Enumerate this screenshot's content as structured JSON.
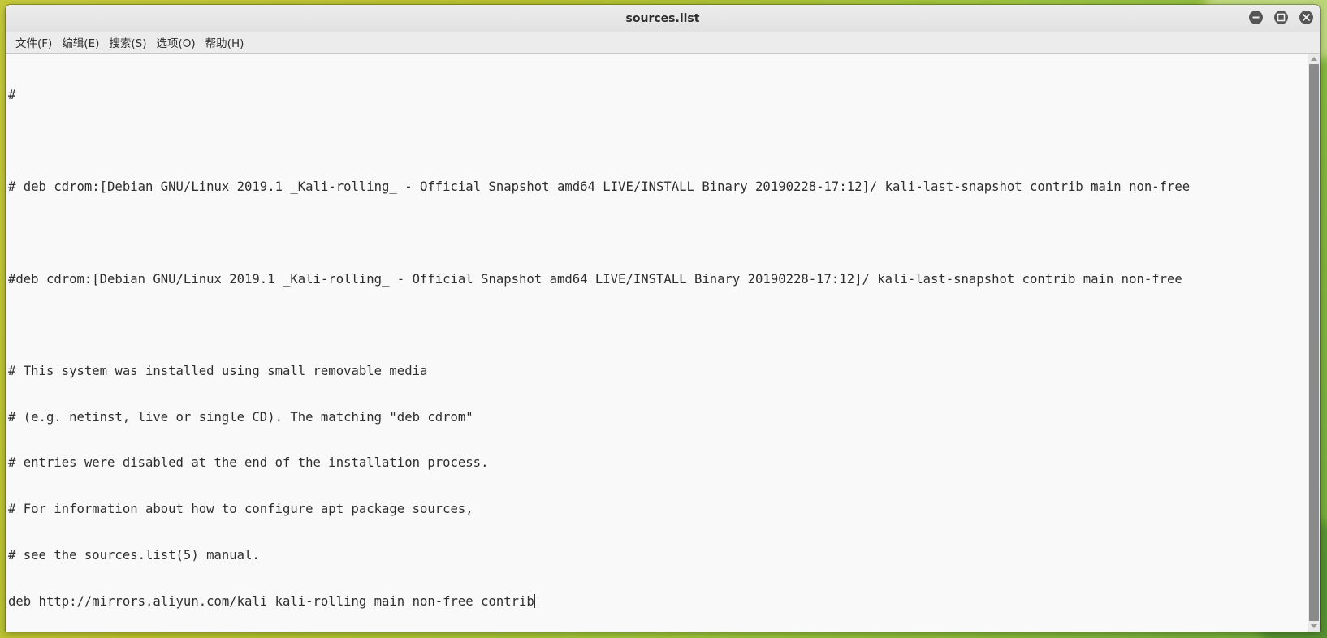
{
  "window": {
    "title": "sources.list"
  },
  "menu": {
    "items": [
      {
        "label": "文件(F)"
      },
      {
        "label": "编辑(E)"
      },
      {
        "label": "搜索(S)"
      },
      {
        "label": "选项(O)"
      },
      {
        "label": "帮助(H)"
      }
    ]
  },
  "editor": {
    "lines": [
      "#",
      "",
      "# deb cdrom:[Debian GNU/Linux 2019.1 _Kali-rolling_ - Official Snapshot amd64 LIVE/INSTALL Binary 20190228-17:12]/ kali-last-snapshot contrib main non-free",
      "",
      "#deb cdrom:[Debian GNU/Linux 2019.1 _Kali-rolling_ - Official Snapshot amd64 LIVE/INSTALL Binary 20190228-17:12]/ kali-last-snapshot contrib main non-free",
      "",
      "# This system was installed using small removable media",
      "# (e.g. netinst, live or single CD). The matching \"deb cdrom\"",
      "# entries were disabled at the end of the installation process.",
      "# For information about how to configure apt package sources,",
      "# see the sources.list(5) manual.",
      "deb http://mirrors.aliyun.com/kali kali-rolling main non-free contrib"
    ]
  },
  "icons": {
    "minimize": "minimize-icon",
    "maximize": "maximize-icon",
    "close": "close-icon"
  }
}
